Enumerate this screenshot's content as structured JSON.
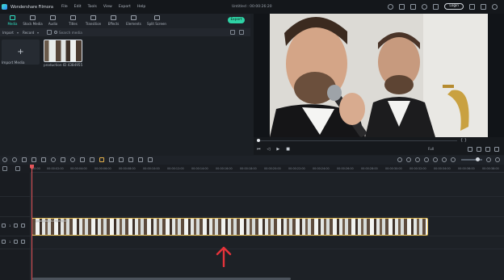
{
  "app": {
    "name": "Wondershare Filmora",
    "menu": [
      "File",
      "Edit",
      "Tools",
      "View",
      "Export",
      "Help"
    ],
    "document_title": "Untitled : 00:00:26:20",
    "login_label": "Login"
  },
  "media_tabs": [
    {
      "label": "Media",
      "icon": "media-icon",
      "active": true
    },
    {
      "label": "Stock Media",
      "icon": "stock-media-icon",
      "active": false
    },
    {
      "label": "Audio",
      "icon": "audio-icon",
      "active": false
    },
    {
      "label": "Titles",
      "icon": "titles-icon",
      "active": false
    },
    {
      "label": "Transition",
      "icon": "transition-icon",
      "active": false
    },
    {
      "label": "Effects",
      "icon": "effects-icon",
      "active": false
    },
    {
      "label": "Elements",
      "icon": "elements-icon",
      "active": false
    },
    {
      "label": "Split Screen",
      "icon": "split-screen-icon",
      "active": false
    }
  ],
  "export_label": "Export",
  "search": {
    "import_label": "Import",
    "sort_label": "Record",
    "placeholder": "Search media"
  },
  "media": {
    "import_card_label": "Import Media",
    "clip_label": "production ID 4384955"
  },
  "preview": {
    "quality": "Full",
    "brackets": "{  }"
  },
  "timeline": {
    "ruler": [
      "00:00",
      "00:00:02:00",
      "00:00:04:00",
      "00:00:06:00",
      "00:00:08:00",
      "00:00:10:00",
      "00:00:12:00",
      "00:00:14:00",
      "00:00:16:00",
      "00:00:18:00",
      "00:00:20:00",
      "00:00:22:00",
      "00:00:24:00",
      "00:00:26:00",
      "00:00:28:00",
      "00:00:30:00",
      "00:00:32:00",
      "00:00:34:00",
      "00:00:36:00",
      "00:00:38:00"
    ],
    "video_track_label": "1",
    "audio_track_label": "1",
    "clip_label": "production ID 4384955"
  },
  "colors": {
    "accent": "#2fe0c3",
    "export_button": "#2ed3a6",
    "playhead": "#e2555a",
    "clip_border": "#e8c25a",
    "arrow": "#e5333a"
  }
}
